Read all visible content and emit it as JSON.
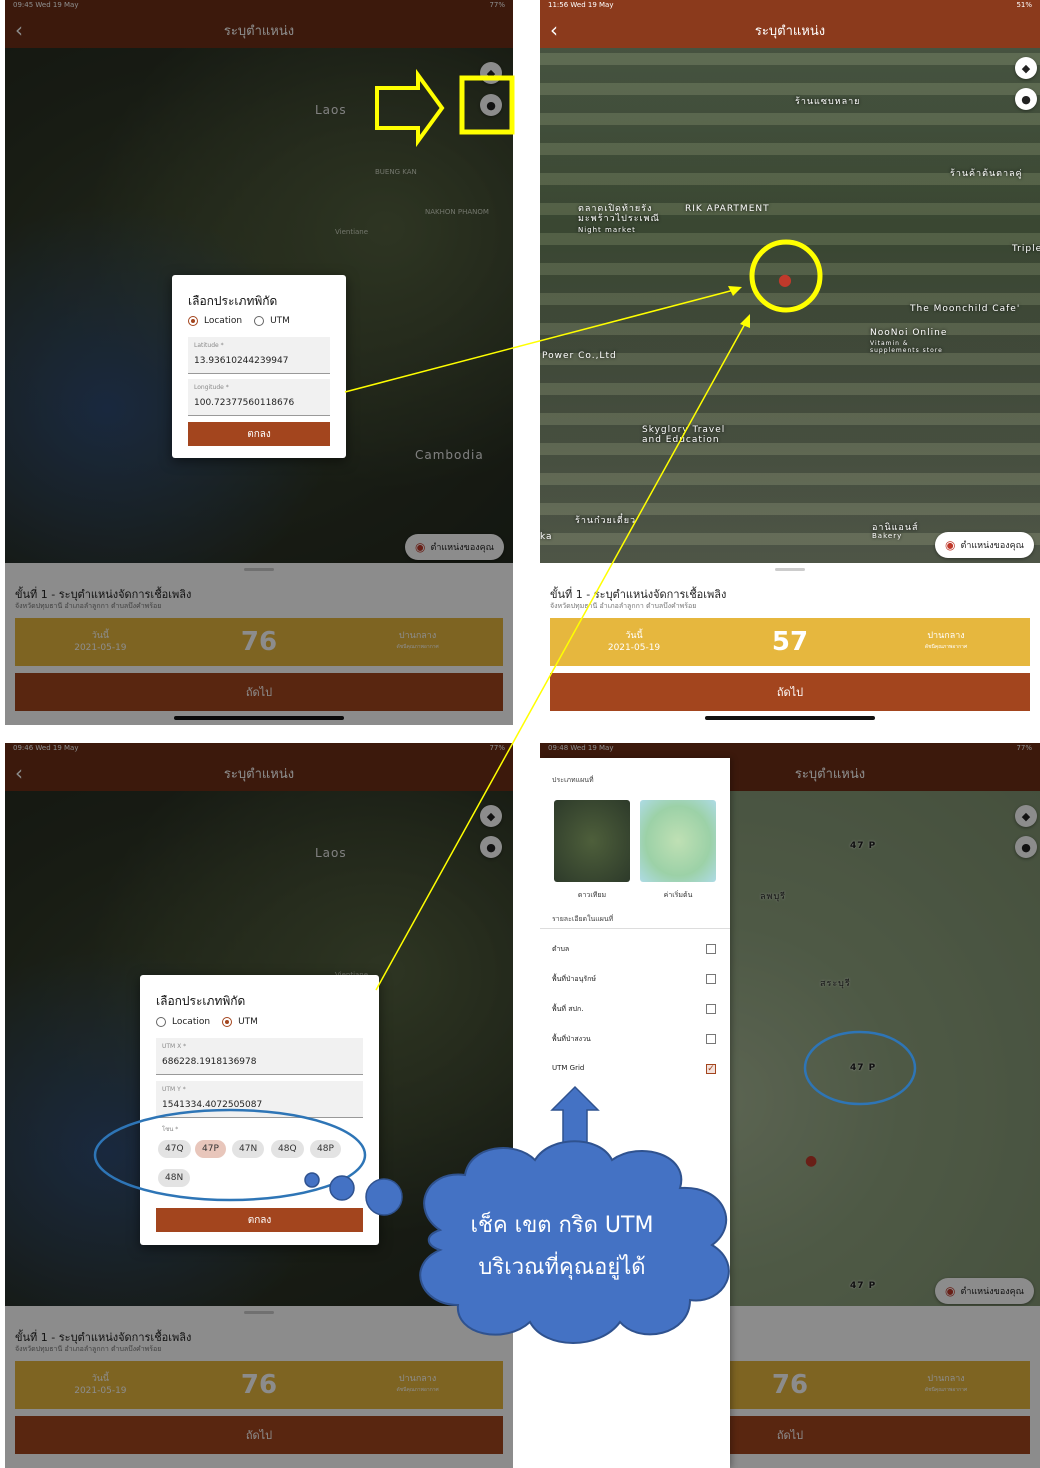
{
  "common": {
    "screen_title": "ระบุตำแหน่ง",
    "back_icon": "chevron-left-icon",
    "locate_label": "ตำแหน่งของคุณ",
    "step_title": "ขั้นที่ 1 - ระบุตำแหน่งจัดการเชื้อเพลิง",
    "step_address": "จังหวัดปทุมธานี อำเภอลำลูกกา ตำบลบึงคำพร้อย",
    "next_label": "ถัดไป",
    "ok_label": "ตกลง",
    "date_label": "วันนี้",
    "date_value": "2021-05-19",
    "level_label": "ปานกลาง",
    "level_sub": "ดัชนีคุณภาพอากาศ"
  },
  "panel1": {
    "status_time": "09:45  Wed 19 May",
    "status_right": "77%",
    "aqi": "76",
    "map_labels": {
      "laos": "Laos",
      "cambodia": "Cambodia"
    },
    "dialog": {
      "title": "เลือกประเภทพิกัด",
      "opt_location": "Location",
      "opt_utm": "UTM",
      "lat_label": "Latitude *",
      "lat_value": "13.93610244239947",
      "lng_label": "Longitude *",
      "lng_value": "100.72377560118676"
    }
  },
  "panel2": {
    "status_time": "11:56  Wed 19 May",
    "status_right": "51%",
    "aqi": "57",
    "places": {
      "p1": "ร้านแซบหลาย",
      "p2": "ร้านค้าต้นตาลคู่",
      "p3": "RIK APARTMENT",
      "p4": "ตลาดเปิดท้ายรัง มะพร้าวไประเพณี",
      "p4b": "Night market",
      "p5": "Triple",
      "p6": "The Moonchild Cafe'",
      "p7": "NooNoi Online",
      "p7b": "Vitamin & supplements store",
      "p8": "Power Co.,Ltd",
      "p9": "Skyglory Travel and Education",
      "p10": "ร้านก๋วยเตี๋ยว",
      "p11": "อานิแอนส์",
      "p11b": "Bakery",
      "p12": "ka"
    }
  },
  "panel3": {
    "status_time": "09:46  Wed 19 May",
    "status_right": "77%",
    "aqi": "76",
    "map_labels": {
      "laos": "Laos"
    },
    "dialog": {
      "title": "เลือกประเภทพิกัด",
      "opt_location": "Location",
      "opt_utm": "UTM",
      "x_label": "UTM X *",
      "x_value": "686228.1918136978",
      "y_label": "UTM Y *",
      "y_value": "1541334.4072505087",
      "zone_label": "โซน *",
      "zones": [
        "47Q",
        "47P",
        "47N",
        "48Q",
        "48P",
        "48N"
      ],
      "selected_zone": "47P"
    }
  },
  "panel4": {
    "status_time": "09:48  Wed 19 May",
    "status_right": "77%",
    "aqi": "76",
    "map_type_heading": "ประเภทแผนที่",
    "map_types": [
      "ดาวเทียม",
      "ค่าเริ่มต้น"
    ],
    "details_heading": "รายละเอียดในแผนที่",
    "layers": [
      {
        "label": "ตำบล",
        "checked": false
      },
      {
        "label": "พื้นที่ป่าอนุรักษ์",
        "checked": false
      },
      {
        "label": "พื้นที่ สปก.",
        "checked": false
      },
      {
        "label": "พื้นที่ป่าสงวน",
        "checked": false
      },
      {
        "label": "UTM Grid",
        "checked": true
      }
    ],
    "grid_labels": [
      "47 P",
      "47 P",
      "47 P"
    ],
    "map_places": {
      "saraburi": "สระบุรี",
      "lopburi": "ลพบุรี"
    }
  },
  "callout": {
    "line1": "เช็ค เขต กริด UTM",
    "line2": "บริเวณที่คุณอยู่ได้"
  },
  "colors": {
    "header": "#8b3a1c",
    "button": "#a3451e",
    "info_bar": "#e6b73e",
    "annotation_yellow": "#ffff00",
    "annotation_blue": "#2e75b6",
    "cloud": "#4472c4"
  }
}
